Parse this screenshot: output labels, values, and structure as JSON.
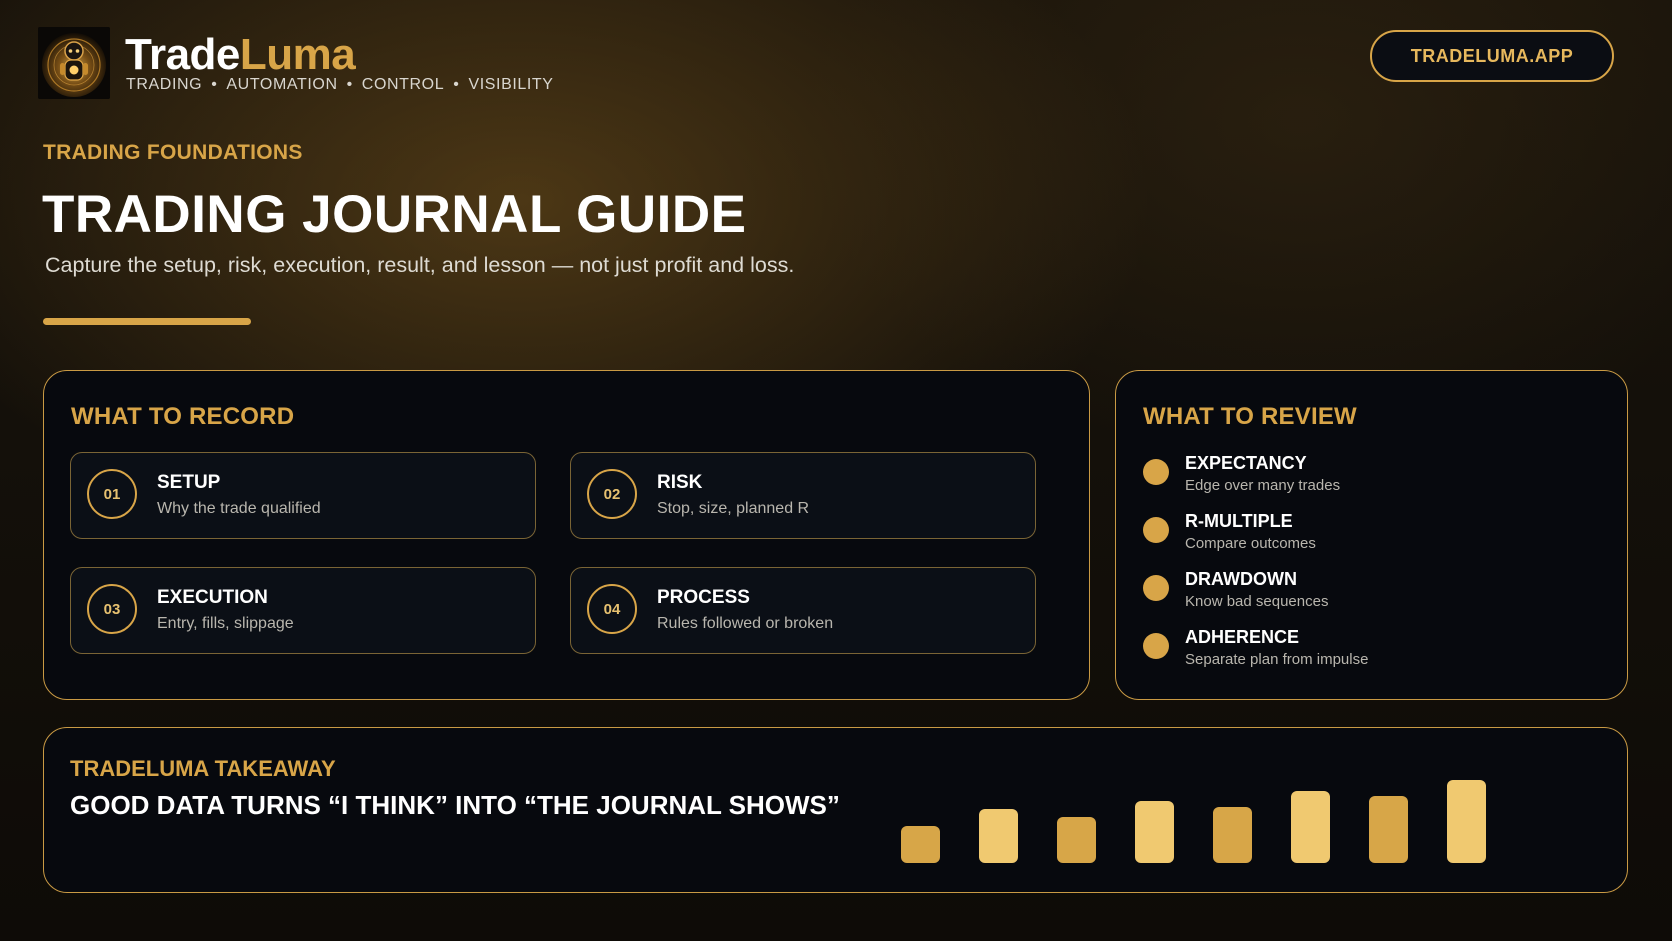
{
  "header": {
    "brand_part1": "Trade",
    "brand_part2": "Luma",
    "tagline": [
      "TRADING",
      "AUTOMATION",
      "CONTROL",
      "VISIBILITY"
    ],
    "site_button": "TRADELUMA.APP",
    "logo_icon": "robot-mascot-icon"
  },
  "hero": {
    "eyebrow": "TRADING FOUNDATIONS",
    "title": "TRADING JOURNAL GUIDE",
    "subtitle": "Capture the setup, risk, execution, result, and lesson — not just profit and loss."
  },
  "record": {
    "title": "WHAT TO RECORD",
    "items": [
      {
        "num": "01",
        "label": "SETUP",
        "desc": "Why the trade qualified"
      },
      {
        "num": "02",
        "label": "RISK",
        "desc": "Stop, size, planned R"
      },
      {
        "num": "03",
        "label": "EXECUTION",
        "desc": "Entry, fills, slippage"
      },
      {
        "num": "04",
        "label": "PROCESS",
        "desc": "Rules followed or broken"
      }
    ]
  },
  "review": {
    "title": "WHAT TO REVIEW",
    "items": [
      {
        "label": "EXPECTANCY",
        "desc": "Edge over many trades"
      },
      {
        "label": "R-MULTIPLE",
        "desc": "Compare outcomes"
      },
      {
        "label": "DRAWDOWN",
        "desc": "Know bad sequences"
      },
      {
        "label": "ADHERENCE",
        "desc": "Separate plan from impulse"
      }
    ]
  },
  "takeaway": {
    "heading": "TRADELUMA TAKEAWAY",
    "text": "GOOD DATA TURNS “I THINK” INTO “THE JOURNAL SHOWS”"
  },
  "decor_bars": {
    "levels": [
      0.45,
      0.65,
      0.55,
      0.75,
      0.68,
      0.87,
      0.81,
      1.0
    ],
    "colors": [
      "#d7a648",
      "#f0c970",
      "#d7a648",
      "#f0c970",
      "#d7a648",
      "#f0c970",
      "#d7a648",
      "#f0c970"
    ]
  },
  "colors": {
    "accent": "#d8a548",
    "panel_bg": "#07090e",
    "page_bg": "#14100a"
  }
}
